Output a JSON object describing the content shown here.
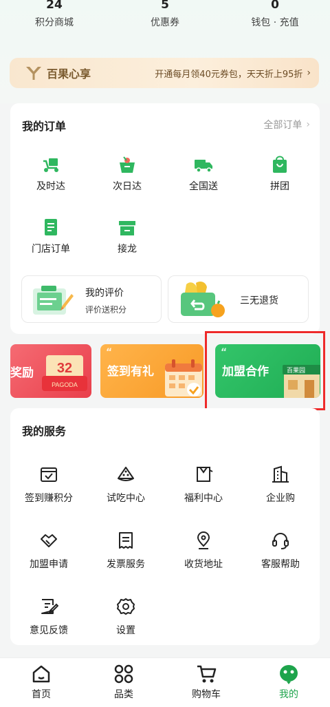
{
  "stats": [
    {
      "num": "24",
      "label": "积分商城"
    },
    {
      "num": "5",
      "label": "优惠券"
    },
    {
      "num": "0",
      "label": "钱包 · 充值"
    }
  ],
  "vip": {
    "logo_text": "百果心享",
    "promo_text": "开通每月领40元券包，天天折上95折",
    "chevron": "›"
  },
  "orders": {
    "title": "我的订单",
    "all_link": "全部订单",
    "chevron": "›",
    "items": [
      {
        "label": "及时达",
        "icon": "scooter-icon"
      },
      {
        "label": "次日达",
        "icon": "fruit-basket-icon"
      },
      {
        "label": "全国送",
        "icon": "truck-icon"
      },
      {
        "label": "拼团",
        "icon": "shopping-bag-icon"
      },
      {
        "label": "门店订单",
        "icon": "store-order-icon"
      },
      {
        "label": "接龙",
        "icon": "shop-icon"
      }
    ],
    "review": {
      "title": "我的评价",
      "subtitle": "评价送积分"
    },
    "refund": {
      "title": "三无退货"
    }
  },
  "promos": [
    {
      "label": "奖励",
      "badge": "32",
      "brand": "PAGODA"
    },
    {
      "label": "签到有礼"
    },
    {
      "label": "加盟合作",
      "sign": "百果园"
    }
  ],
  "services": {
    "title": "我的服务",
    "items": [
      {
        "label": "签到赚积分",
        "icon": "calendar-check-icon"
      },
      {
        "label": "试吃中心",
        "icon": "watermelon-icon"
      },
      {
        "label": "福利中心",
        "icon": "gift-card-icon"
      },
      {
        "label": "企业购",
        "icon": "building-icon"
      },
      {
        "label": "加盟申请",
        "icon": "handshake-icon"
      },
      {
        "label": "发票服务",
        "icon": "receipt-icon"
      },
      {
        "label": "收货地址",
        "icon": "location-pin-icon"
      },
      {
        "label": "客服帮助",
        "icon": "headset-icon"
      },
      {
        "label": "意见反馈",
        "icon": "feedback-icon"
      },
      {
        "label": "设置",
        "icon": "gear-icon"
      }
    ]
  },
  "tabs": [
    {
      "label": "首页",
      "icon": "home-icon"
    },
    {
      "label": "品类",
      "icon": "category-icon"
    },
    {
      "label": "购物车",
      "icon": "cart-icon"
    },
    {
      "label": "我的",
      "icon": "profile-icon",
      "active": true
    }
  ],
  "colors": {
    "accent_green": "#1ea44c",
    "highlight_red": "#ee2a2a",
    "vip_gold": "#7a5a2e"
  }
}
